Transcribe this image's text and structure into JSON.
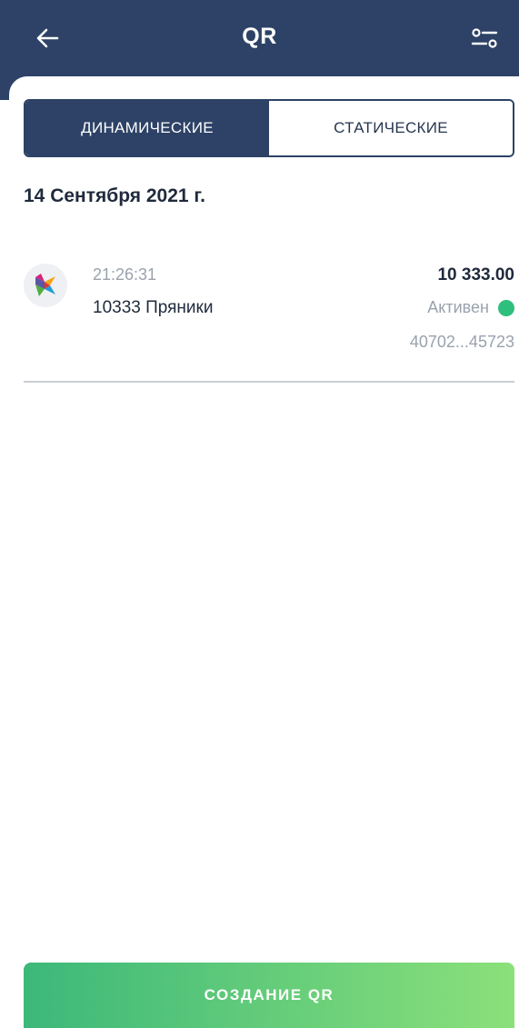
{
  "header": {
    "title": "QR",
    "back_icon": "arrow-left-icon",
    "filter_icon": "filter-sliders-icon"
  },
  "tabs": [
    {
      "label": "ДИНАМИЧЕСКИЕ",
      "active": true
    },
    {
      "label": "СТАТИЧЕСКИЕ",
      "active": false
    }
  ],
  "date_group": "14 Сентября 2021 г.",
  "transactions": [
    {
      "time": "21:26:31",
      "name": "10333 Пряники",
      "amount": "10 333.00",
      "status": "Активен",
      "account": "40702...45723",
      "icon": "sbp-logo-icon"
    }
  ],
  "create_button": {
    "label": "СОЗДАНИЕ QR"
  },
  "colors": {
    "header_bg": "#2d4266",
    "status_active": "#2fbf7c",
    "button_gradient_start": "#3cb87a",
    "button_gradient_end": "#8be07a"
  }
}
